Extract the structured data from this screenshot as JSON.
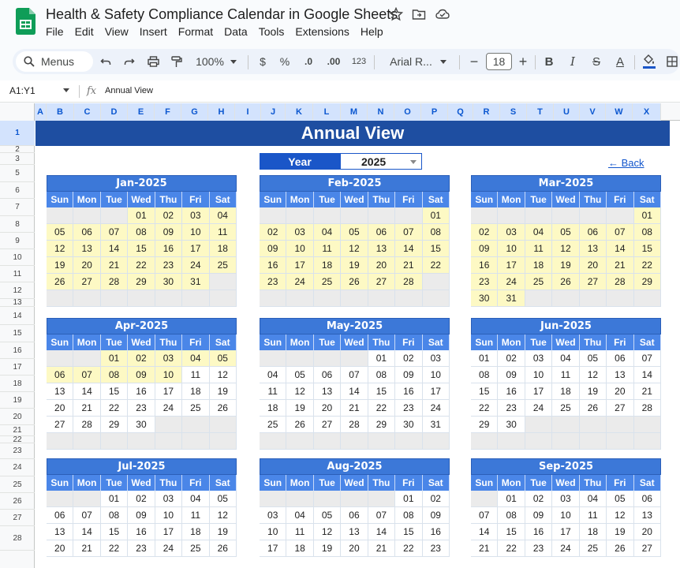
{
  "app": {
    "title": "Health & Safety Compliance Calendar in Google Sheets",
    "menus": [
      "File",
      "Edit",
      "View",
      "Insert",
      "Format",
      "Data",
      "Tools",
      "Extensions",
      "Help"
    ]
  },
  "toolbar": {
    "search_label": "Menus",
    "zoom": "100%",
    "currency": "$",
    "percent": "%",
    "dec_decrease": ".0",
    "dec_increase": ".00",
    "number_format": "123",
    "font": "Arial R...",
    "font_size": "18",
    "minus": "−",
    "plus": "+",
    "bold": "B",
    "italic": "I",
    "strike": "S",
    "text_color": "A"
  },
  "formula_bar": {
    "name_box": "A1:Y1",
    "fx": "fx",
    "value": "Annual View"
  },
  "columns": [
    "A",
    "B",
    "C",
    "D",
    "E",
    "F",
    "G",
    "H",
    "I",
    "J",
    "K",
    "L",
    "M",
    "N",
    "O",
    "P",
    "Q",
    "R",
    "S",
    "T",
    "U",
    "V",
    "W",
    "X"
  ],
  "rows": [
    "1",
    "2",
    "3",
    "5",
    "6",
    "7",
    "8",
    "9",
    "10",
    "11",
    "12",
    "13",
    "14",
    "15",
    "16",
    "17",
    "18",
    "19",
    "20",
    "21",
    "22",
    "23",
    "24",
    "25",
    "26",
    "27",
    "28"
  ],
  "sheet": {
    "banner": "Annual View",
    "year_label": "Year",
    "year_value": "2025",
    "back_link": "← Back",
    "dow": [
      "Sun",
      "Mon",
      "Tue",
      "Wed",
      "Thu",
      "Fri",
      "Sat"
    ]
  },
  "months": [
    {
      "name": "Jan-2025",
      "weeks": [
        [
          "",
          "",
          "",
          "01",
          "02",
          "03",
          "04"
        ],
        [
          "05",
          "06",
          "07",
          "08",
          "09",
          "10",
          "11"
        ],
        [
          "12",
          "13",
          "14",
          "15",
          "16",
          "17",
          "18"
        ],
        [
          "19",
          "20",
          "21",
          "22",
          "23",
          "24",
          "25"
        ],
        [
          "26",
          "27",
          "28",
          "29",
          "30",
          "31",
          ""
        ],
        [
          "",
          "",
          "",
          "",
          "",
          "",
          ""
        ]
      ],
      "hl": "all"
    },
    {
      "name": "Feb-2025",
      "weeks": [
        [
          "",
          "",
          "",
          "",
          "",
          "",
          "01"
        ],
        [
          "02",
          "03",
          "04",
          "05",
          "06",
          "07",
          "08"
        ],
        [
          "09",
          "10",
          "11",
          "12",
          "13",
          "14",
          "15"
        ],
        [
          "16",
          "17",
          "18",
          "19",
          "20",
          "21",
          "22"
        ],
        [
          "23",
          "24",
          "25",
          "26",
          "27",
          "28",
          ""
        ],
        [
          "",
          "",
          "",
          "",
          "",
          "",
          ""
        ]
      ],
      "hl": "all"
    },
    {
      "name": "Mar-2025",
      "weeks": [
        [
          "",
          "",
          "",
          "",
          "",
          "",
          "01"
        ],
        [
          "02",
          "03",
          "04",
          "05",
          "06",
          "07",
          "08"
        ],
        [
          "09",
          "10",
          "11",
          "12",
          "13",
          "14",
          "15"
        ],
        [
          "16",
          "17",
          "18",
          "19",
          "20",
          "21",
          "22"
        ],
        [
          "23",
          "24",
          "25",
          "26",
          "27",
          "28",
          "29"
        ],
        [
          "30",
          "31",
          "",
          "",
          "",
          "",
          ""
        ]
      ],
      "hl": "all"
    },
    {
      "name": "Apr-2025",
      "weeks": [
        [
          "",
          "",
          "01",
          "02",
          "03",
          "04",
          "05"
        ],
        [
          "06",
          "07",
          "08",
          "09",
          "10",
          "11",
          "12"
        ],
        [
          "13",
          "14",
          "15",
          "16",
          "17",
          "18",
          "19"
        ],
        [
          "20",
          "21",
          "22",
          "23",
          "24",
          "25",
          "26"
        ],
        [
          "27",
          "28",
          "29",
          "30",
          "",
          "",
          ""
        ],
        [
          "",
          "",
          "",
          "",
          "",
          "",
          ""
        ]
      ],
      "hl": "apr"
    },
    {
      "name": "May-2025",
      "weeks": [
        [
          "",
          "",
          "",
          "",
          "01",
          "02",
          "03"
        ],
        [
          "04",
          "05",
          "06",
          "07",
          "08",
          "09",
          "10"
        ],
        [
          "11",
          "12",
          "13",
          "14",
          "15",
          "16",
          "17"
        ],
        [
          "18",
          "19",
          "20",
          "21",
          "22",
          "23",
          "24"
        ],
        [
          "25",
          "26",
          "27",
          "28",
          "29",
          "30",
          "31"
        ],
        [
          "",
          "",
          "",
          "",
          "",
          "",
          ""
        ]
      ],
      "hl": "none"
    },
    {
      "name": "Jun-2025",
      "weeks": [
        [
          "01",
          "02",
          "03",
          "04",
          "05",
          "06",
          "07"
        ],
        [
          "08",
          "09",
          "10",
          "11",
          "12",
          "13",
          "14"
        ],
        [
          "15",
          "16",
          "17",
          "18",
          "19",
          "20",
          "21"
        ],
        [
          "22",
          "23",
          "24",
          "25",
          "26",
          "27",
          "28"
        ],
        [
          "29",
          "30",
          "",
          "",
          "",
          "",
          ""
        ],
        [
          "",
          "",
          "",
          "",
          "",
          "",
          ""
        ]
      ],
      "hl": "none"
    },
    {
      "name": "Jul-2025",
      "weeks": [
        [
          "",
          "",
          "01",
          "02",
          "03",
          "04",
          "05"
        ],
        [
          "06",
          "07",
          "08",
          "09",
          "10",
          "11",
          "12"
        ],
        [
          "13",
          "14",
          "15",
          "16",
          "17",
          "18",
          "19"
        ],
        [
          "20",
          "21",
          "22",
          "23",
          "24",
          "25",
          "26"
        ]
      ],
      "hl": "none"
    },
    {
      "name": "Aug-2025",
      "weeks": [
        [
          "",
          "",
          "",
          "",
          "",
          "01",
          "02"
        ],
        [
          "03",
          "04",
          "05",
          "06",
          "07",
          "08",
          "09"
        ],
        [
          "10",
          "11",
          "12",
          "13",
          "14",
          "15",
          "16"
        ],
        [
          "17",
          "18",
          "19",
          "20",
          "21",
          "22",
          "23"
        ]
      ],
      "hl": "none"
    },
    {
      "name": "Sep-2025",
      "weeks": [
        [
          "",
          "01",
          "02",
          "03",
          "04",
          "05",
          "06"
        ],
        [
          "07",
          "08",
          "09",
          "10",
          "11",
          "12",
          "13"
        ],
        [
          "14",
          "15",
          "16",
          "17",
          "18",
          "19",
          "20"
        ],
        [
          "21",
          "22",
          "23",
          "24",
          "25",
          "26",
          "27"
        ]
      ],
      "hl": "none"
    }
  ]
}
